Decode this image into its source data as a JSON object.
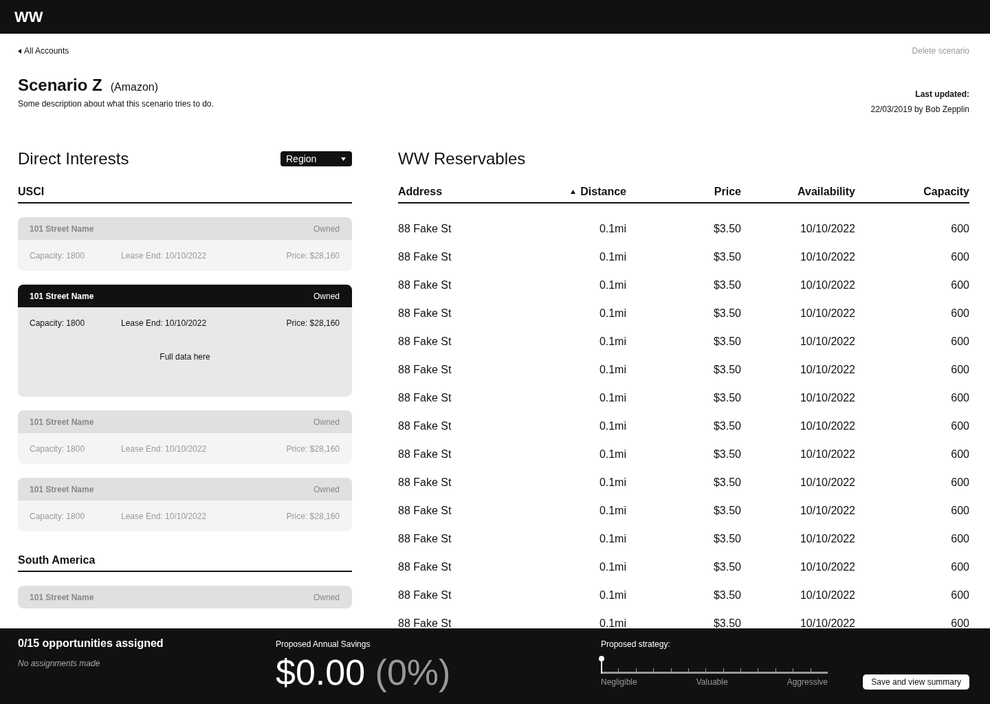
{
  "header": {
    "logo": "WW"
  },
  "top": {
    "back_link": "All Accounts",
    "delete_link": "Delete scenario",
    "title": "Scenario Z",
    "account": "(Amazon)",
    "description": "Some description about what this scenario tries to do.",
    "updated_label": "Last updated:",
    "updated_value": "22/03/2019 by Bob Zepplin"
  },
  "direct_interests": {
    "title": "Direct Interests",
    "filter": "Region",
    "sections": [
      {
        "name": "USCI",
        "cards": [
          {
            "name": "101 Street Name",
            "status": "Owned",
            "capacity": "Capacity: 1800",
            "lease_end": "Lease End: 10/10/2022",
            "price": "Price: $28,160",
            "selected": false
          },
          {
            "name": "101 Street Name",
            "status": "Owned",
            "capacity": "Capacity: 1800",
            "lease_end": "Lease End: 10/10/2022",
            "price": "Price: $28,160",
            "selected": true,
            "detail": "Full data here"
          },
          {
            "name": "101 Street Name",
            "status": "Owned",
            "capacity": "Capacity: 1800",
            "lease_end": "Lease End: 10/10/2022",
            "price": "Price: $28,160",
            "selected": false
          },
          {
            "name": "101 Street Name",
            "status": "Owned",
            "capacity": "Capacity: 1800",
            "lease_end": "Lease End: 10/10/2022",
            "price": "Price: $28,160",
            "selected": false
          }
        ]
      },
      {
        "name": "South America",
        "cards": [
          {
            "name": "101 Street Name",
            "status": "Owned",
            "selected": false
          }
        ]
      }
    ]
  },
  "reservables": {
    "title": "WW Reservables",
    "columns": [
      {
        "label": "Address",
        "sorted": false
      },
      {
        "label": "Distance",
        "sorted": true
      },
      {
        "label": "Price",
        "sorted": false
      },
      {
        "label": "Availability",
        "sorted": false
      },
      {
        "label": "Capacity",
        "sorted": false
      }
    ],
    "rows": [
      [
        "88 Fake St",
        "0.1mi",
        "$3.50",
        "10/10/2022",
        "600"
      ],
      [
        "88 Fake St",
        "0.1mi",
        "$3.50",
        "10/10/2022",
        "600"
      ],
      [
        "88 Fake St",
        "0.1mi",
        "$3.50",
        "10/10/2022",
        "600"
      ],
      [
        "88 Fake St",
        "0.1mi",
        "$3.50",
        "10/10/2022",
        "600"
      ],
      [
        "88 Fake St",
        "0.1mi",
        "$3.50",
        "10/10/2022",
        "600"
      ],
      [
        "88 Fake St",
        "0.1mi",
        "$3.50",
        "10/10/2022",
        "600"
      ],
      [
        "88 Fake St",
        "0.1mi",
        "$3.50",
        "10/10/2022",
        "600"
      ],
      [
        "88 Fake St",
        "0.1mi",
        "$3.50",
        "10/10/2022",
        "600"
      ],
      [
        "88 Fake St",
        "0.1mi",
        "$3.50",
        "10/10/2022",
        "600"
      ],
      [
        "88 Fake St",
        "0.1mi",
        "$3.50",
        "10/10/2022",
        "600"
      ],
      [
        "88 Fake St",
        "0.1mi",
        "$3.50",
        "10/10/2022",
        "600"
      ],
      [
        "88 Fake St",
        "0.1mi",
        "$3.50",
        "10/10/2022",
        "600"
      ],
      [
        "88 Fake St",
        "0.1mi",
        "$3.50",
        "10/10/2022",
        "600"
      ],
      [
        "88 Fake St",
        "0.1mi",
        "$3.50",
        "10/10/2022",
        "600"
      ],
      [
        "88 Fake St",
        "0.1mi",
        "$3.50",
        "10/10/2022",
        "600"
      ]
    ]
  },
  "footer": {
    "assigned": "0/15 opportunities assigned",
    "assigned_note": "No assignments made",
    "savings_label": "Proposed Annual Savings",
    "savings_amount": "$0.00",
    "savings_percent": "(0%)",
    "strategy_label": "Proposed strategy:",
    "strategy": {
      "level": 0,
      "labels": [
        "Negligible",
        "Valuable",
        "Aggressive"
      ]
    },
    "save_button": "Save and view summary"
  }
}
